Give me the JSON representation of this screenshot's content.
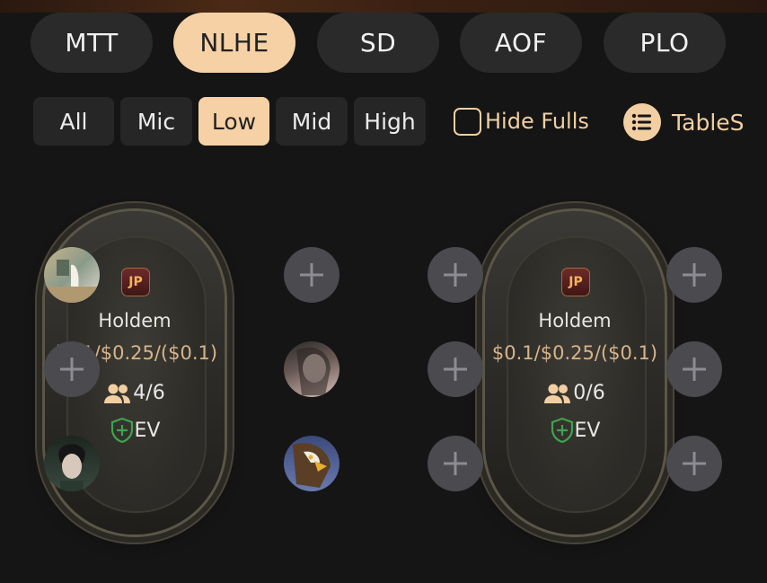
{
  "game_tabs": [
    {
      "label": "MTT",
      "active": false
    },
    {
      "label": "NLHE",
      "active": true
    },
    {
      "label": "SD",
      "active": false
    },
    {
      "label": "AOF",
      "active": false
    },
    {
      "label": "PLO",
      "active": false
    }
  ],
  "stakes": [
    {
      "label": "All",
      "active": false
    },
    {
      "label": "Mic",
      "active": false
    },
    {
      "label": "Low",
      "active": true
    },
    {
      "label": "Mid",
      "active": false
    },
    {
      "label": "High",
      "active": false
    }
  ],
  "filters": {
    "hide_fulls_label": "Hide Fulls",
    "hide_fulls_checked": false,
    "tables_label": "TableS"
  },
  "tables": [
    {
      "badge": "JP",
      "game": "Holdem",
      "blinds": "$0.1/$0.25/($0.1)",
      "players": "4/6",
      "ev": "EV"
    },
    {
      "badge": "JP",
      "game": "Holdem",
      "blinds": "$0.1/$0.25/($0.1)",
      "players": "0/6",
      "ev": "EV"
    }
  ],
  "colors": {
    "accent": "#f6d1a5",
    "ev_green": "#3fa34d",
    "background": "#151515"
  }
}
